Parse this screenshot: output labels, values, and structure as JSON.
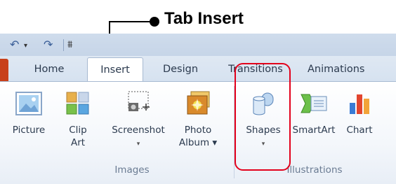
{
  "annotation": {
    "label": "Tab Insert"
  },
  "quick_access": {
    "undo": "↶",
    "undo_arrow": "▾",
    "redo": "↷",
    "customize": "⩩"
  },
  "tabs": [
    "Home",
    "Insert",
    "Design",
    "Transitions",
    "Animations"
  ],
  "active_tab": "Insert",
  "groups": {
    "images": {
      "label": "Images",
      "buttons": [
        {
          "label": "Picture"
        },
        {
          "label": "Clip",
          "label2": "Art"
        },
        {
          "label": "Screenshot",
          "arrow": "▾"
        },
        {
          "label": "Photo",
          "label2": "Album ▾"
        }
      ]
    },
    "illustrations": {
      "label": "Illustrations",
      "buttons": [
        {
          "label": "Shapes",
          "arrow": "▾"
        },
        {
          "label": "SmartArt"
        },
        {
          "label": "Chart"
        }
      ]
    }
  },
  "colors": {
    "highlight": "#e3001b",
    "file_tab": "#c8401b",
    "accent": "#3b5f98"
  }
}
